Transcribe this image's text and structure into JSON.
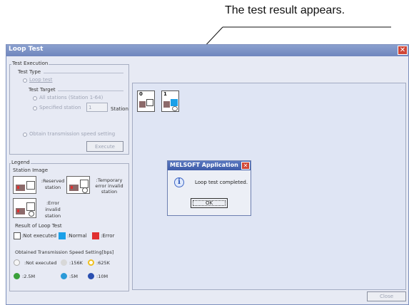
{
  "annotation": {
    "caption": "The test result appears."
  },
  "window": {
    "title": "Loop Test",
    "close_glyph": "✕"
  },
  "test_execution": {
    "group_label": "Test Execution",
    "test_type_label": "Test Type",
    "loop_test_label": "Loop test",
    "test_target_label": "Test Target",
    "all_stations_label": "All stations (Station 1-64)",
    "specified_station_label": "Specified station",
    "specified_station_value": "1",
    "station_unit": "Station",
    "obtain_speed_label": "Obtain transmission speed setting",
    "execute_label": "Execute"
  },
  "legend": {
    "group_label": "Legend",
    "station_image_label": "Station Image",
    "reserved_label": ":Reserved station",
    "temporary_error_label": ":Temporary error invalid station",
    "error_invalid_label": ":Error invalid station",
    "result_title": "Result of Loop Test",
    "not_executed_label": ":Not executed",
    "normal_label": ":Normal",
    "error_label": ":Error",
    "speed_title": "Obtained Transmission Speed Setting[bps]",
    "speed_not_executed": ":Not executed",
    "speed_156k": ":156K",
    "speed_625k": ":625K",
    "speed_2_5m": ":2.5M",
    "speed_5m": ":5M",
    "speed_10m": ":10M"
  },
  "stations": [
    {
      "number": "0"
    },
    {
      "number": "1"
    }
  ],
  "dialog": {
    "title": "MELSOFT Application",
    "message": "Loop test completed.",
    "ok_label": "OK",
    "close_glyph": "✕"
  },
  "footer": {
    "close_label": "Close"
  },
  "colors": {
    "normal": "#1aa0e8",
    "error": "#e03030",
    "speed_156k": "#d8d8d8",
    "speed_625k": "#f0c020",
    "speed_2_5m": "#3aa03a",
    "speed_5m": "#2a9ad8",
    "speed_10m": "#2a4fb0"
  }
}
